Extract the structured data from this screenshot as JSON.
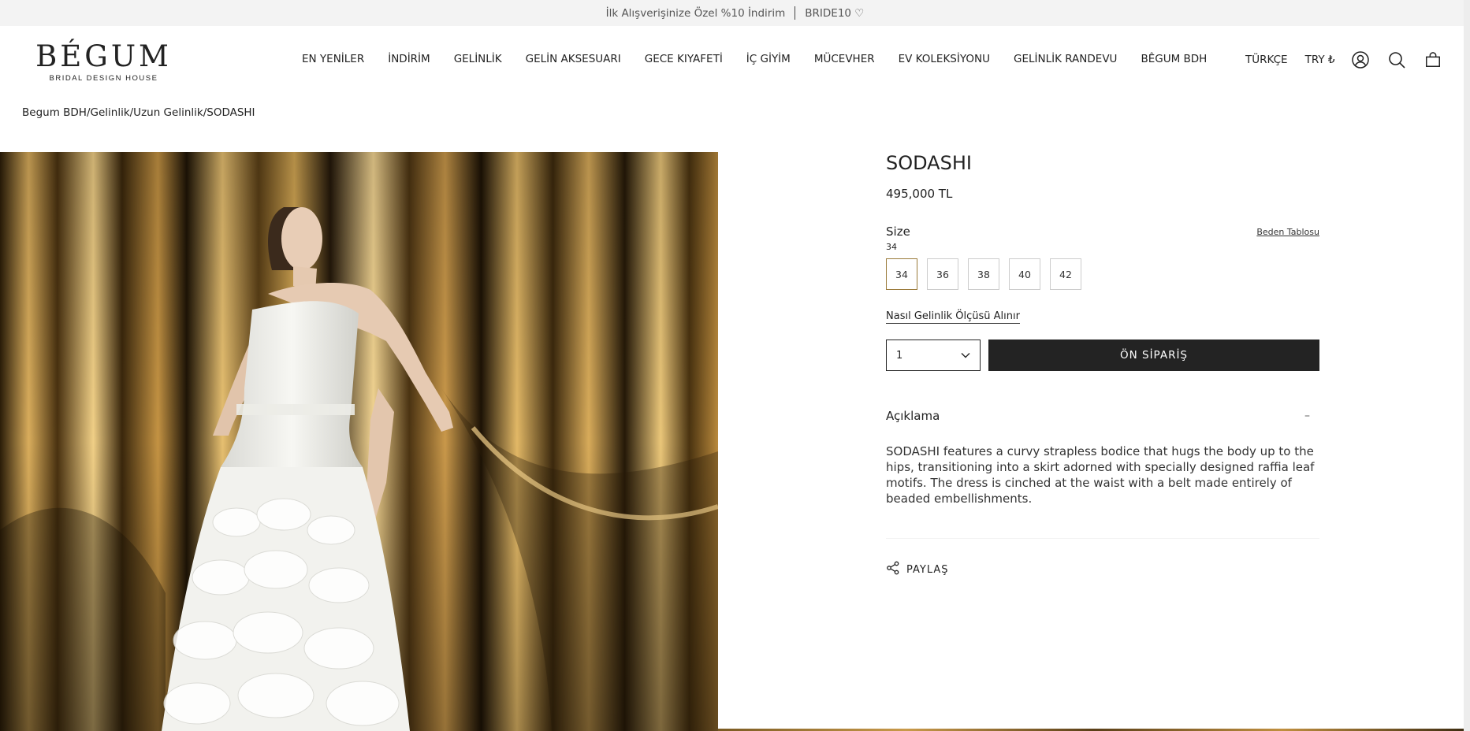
{
  "announcement": {
    "promo_text": "İlk Alışverişinize Özel %10 İndirim",
    "code": "BRIDE10 ♡"
  },
  "logo": {
    "brand": "BÉGUM",
    "subtitle": "BRIDAL DESIGN HOUSE"
  },
  "nav": {
    "items": [
      {
        "label": "EN YENİLER"
      },
      {
        "label": "İNDİRİM"
      },
      {
        "label": "GELİNLİK"
      },
      {
        "label": "GELİN AKSESUARI"
      },
      {
        "label": "GECE KIYAFETİ"
      },
      {
        "label": "İÇ GİYİM"
      },
      {
        "label": "MÜCEVHER"
      },
      {
        "label": "EV KOLEKSİYONU"
      },
      {
        "label": "GELİNLİK RANDEVU"
      },
      {
        "label": "BÊGUM BDH"
      }
    ]
  },
  "header_right": {
    "language": "TÜRKÇE",
    "currency": "TRY ₺",
    "icons": [
      "account-icon",
      "search-icon",
      "cart-icon"
    ]
  },
  "breadcrumb": "Begum BDH/Gelinlik/Uzun Gelinlik/SODASHI",
  "product": {
    "title": "SODASHI",
    "price": "495,000 TL",
    "size_label": "Size",
    "size_chart_link": "Beden Tablosu",
    "selected_size": "34",
    "sizes": [
      "34",
      "36",
      "38",
      "40",
      "42"
    ],
    "measure_link": "Nasıl Gelinlik Ölçüsü Alınır",
    "quantity": "1",
    "preorder_label": "ÖN SİPARİŞ",
    "accordion_title": "Açıklama",
    "accordion_toggle": "–",
    "description": "SODASHI features a curvy strapless bodice that hugs the body up to the hips, transitioning into a skirt adorned with specially designed raffia leaf motifs. The dress is cinched at the waist with a belt made entirely of beaded embellishments.",
    "share_label": "PAYLAŞ"
  },
  "colors": {
    "announcement_bg": "#f3f3f3",
    "button_dark": "#232323",
    "active_size_border": "#9a7a3a",
    "curtain_gold": "#b8893a"
  }
}
